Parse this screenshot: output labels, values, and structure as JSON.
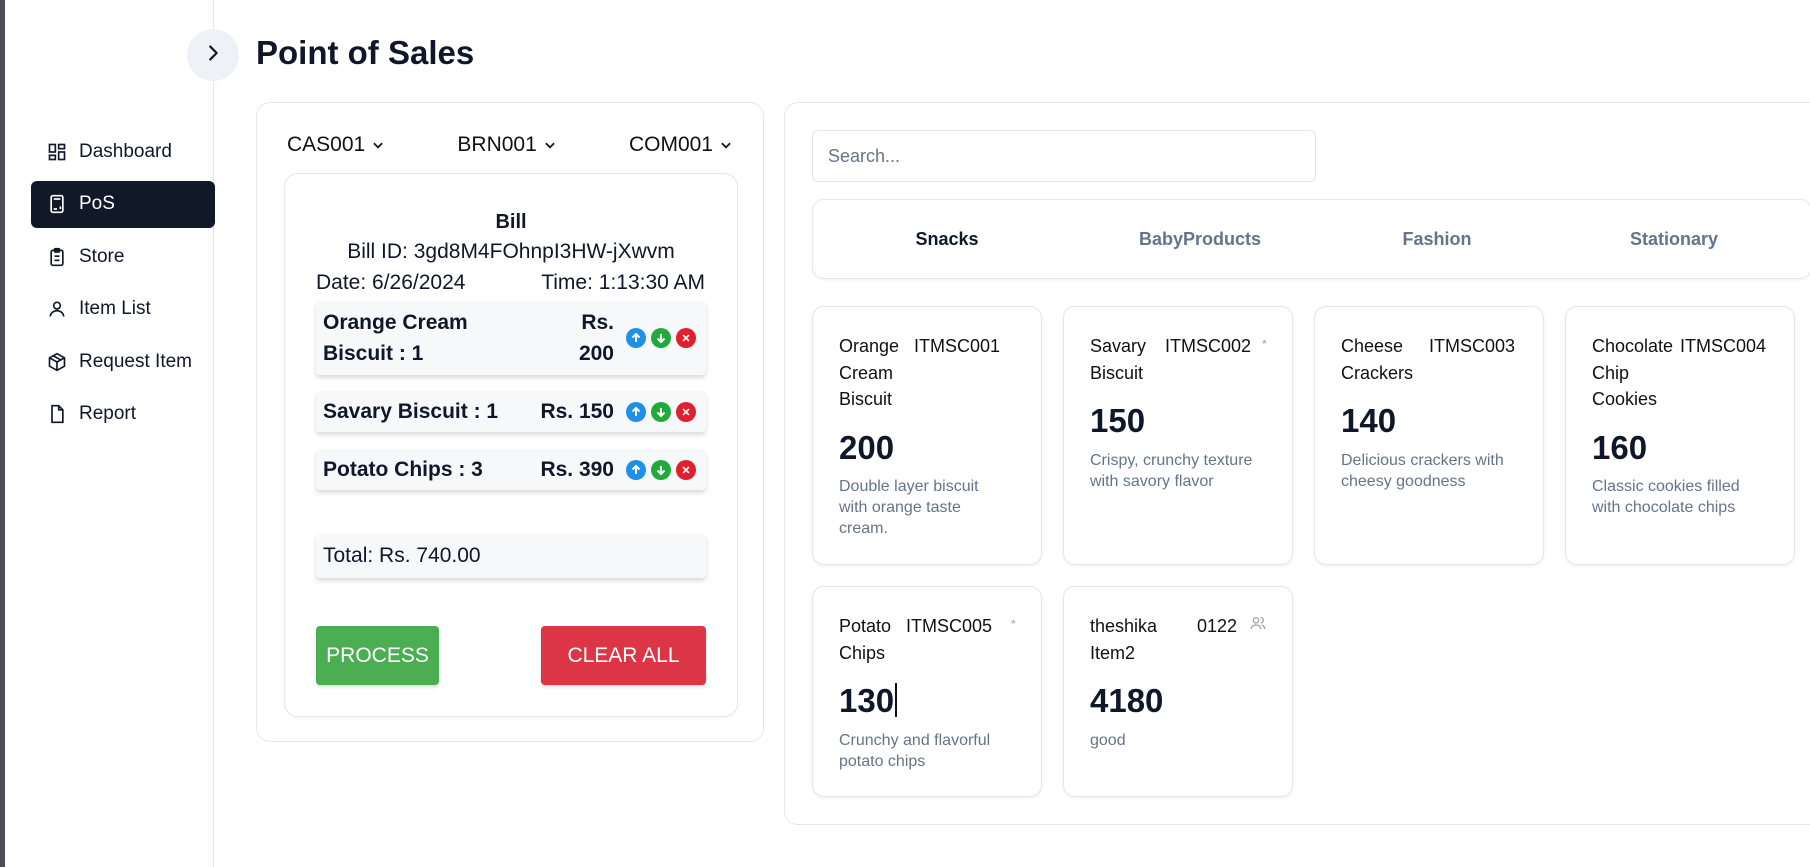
{
  "page_title": "Point of Sales",
  "sidebar": {
    "items": [
      {
        "label": "Dashboard",
        "icon": "dashboard-icon",
        "active": false
      },
      {
        "label": "PoS",
        "icon": "calculator-icon",
        "active": true
      },
      {
        "label": "Store",
        "icon": "clipboard-icon",
        "active": false
      },
      {
        "label": "Item List",
        "icon": "user-icon",
        "active": false
      },
      {
        "label": "Request Item",
        "icon": "package-icon",
        "active": false
      },
      {
        "label": "Report",
        "icon": "file-icon",
        "active": false
      }
    ]
  },
  "selectors": {
    "cashier": "CAS001",
    "branch": "BRN001",
    "company": "COM001"
  },
  "bill": {
    "title": "Bill",
    "bill_id": "Bill ID: 3gd8M4FOhnpI3HW-jXwvm",
    "date": "Date: 6/26/2024",
    "time": "Time: 1:13:30 AM",
    "items": [
      {
        "name_line1": "Orange Cream",
        "name_line2": "Biscuit : 1",
        "price_line1": "Rs.",
        "price_line2": "200"
      },
      {
        "name": "Savary Biscuit : 1",
        "price": "Rs. 150"
      },
      {
        "name": "Potato Chips : 3",
        "price": "Rs. 390"
      }
    ],
    "total": "Total: Rs. 740.00",
    "process_label": "PROCESS",
    "clear_label": "CLEAR ALL"
  },
  "search": {
    "placeholder": "Search...",
    "value": ""
  },
  "categories": [
    {
      "label": "Snacks",
      "active": true
    },
    {
      "label": "BabyProducts",
      "active": false
    },
    {
      "label": "Fashion",
      "active": false
    },
    {
      "label": "Stationary",
      "active": false
    }
  ],
  "products": [
    {
      "name": "Orange Cream Biscuit",
      "code": "ITMSC001",
      "price": "200",
      "description": "Double layer biscuit with orange taste cream."
    },
    {
      "name": "Savary Biscuit",
      "code": "ITMSC002",
      "mark": "*",
      "price": "150",
      "description": "Crispy, crunchy texture with savory flavor"
    },
    {
      "name": "Cheese Crackers",
      "code": "ITMSC003",
      "price": "140",
      "description": "Delicious crackers with cheesy goodness"
    },
    {
      "name": "Chocolate Chip Cookies",
      "code": "ITMSC004",
      "price": "160",
      "description": "Classic cookies filled with chocolate chips"
    },
    {
      "name": "Potato Chips",
      "code": "ITMSC005",
      "mark": "*",
      "price": "130",
      "description": "Crunchy and flavorful potato chips"
    },
    {
      "name": "theshika Item2",
      "code": "0122",
      "icon": "users-icon",
      "price": "4180",
      "description": "good"
    }
  ],
  "colors": {
    "sidebar_active": "#111827",
    "process": "#4cae52",
    "clear": "#dc3545",
    "up": "#1e90e8",
    "down": "#22a93c",
    "remove": "#e0202f",
    "muted_text": "#64748b"
  }
}
